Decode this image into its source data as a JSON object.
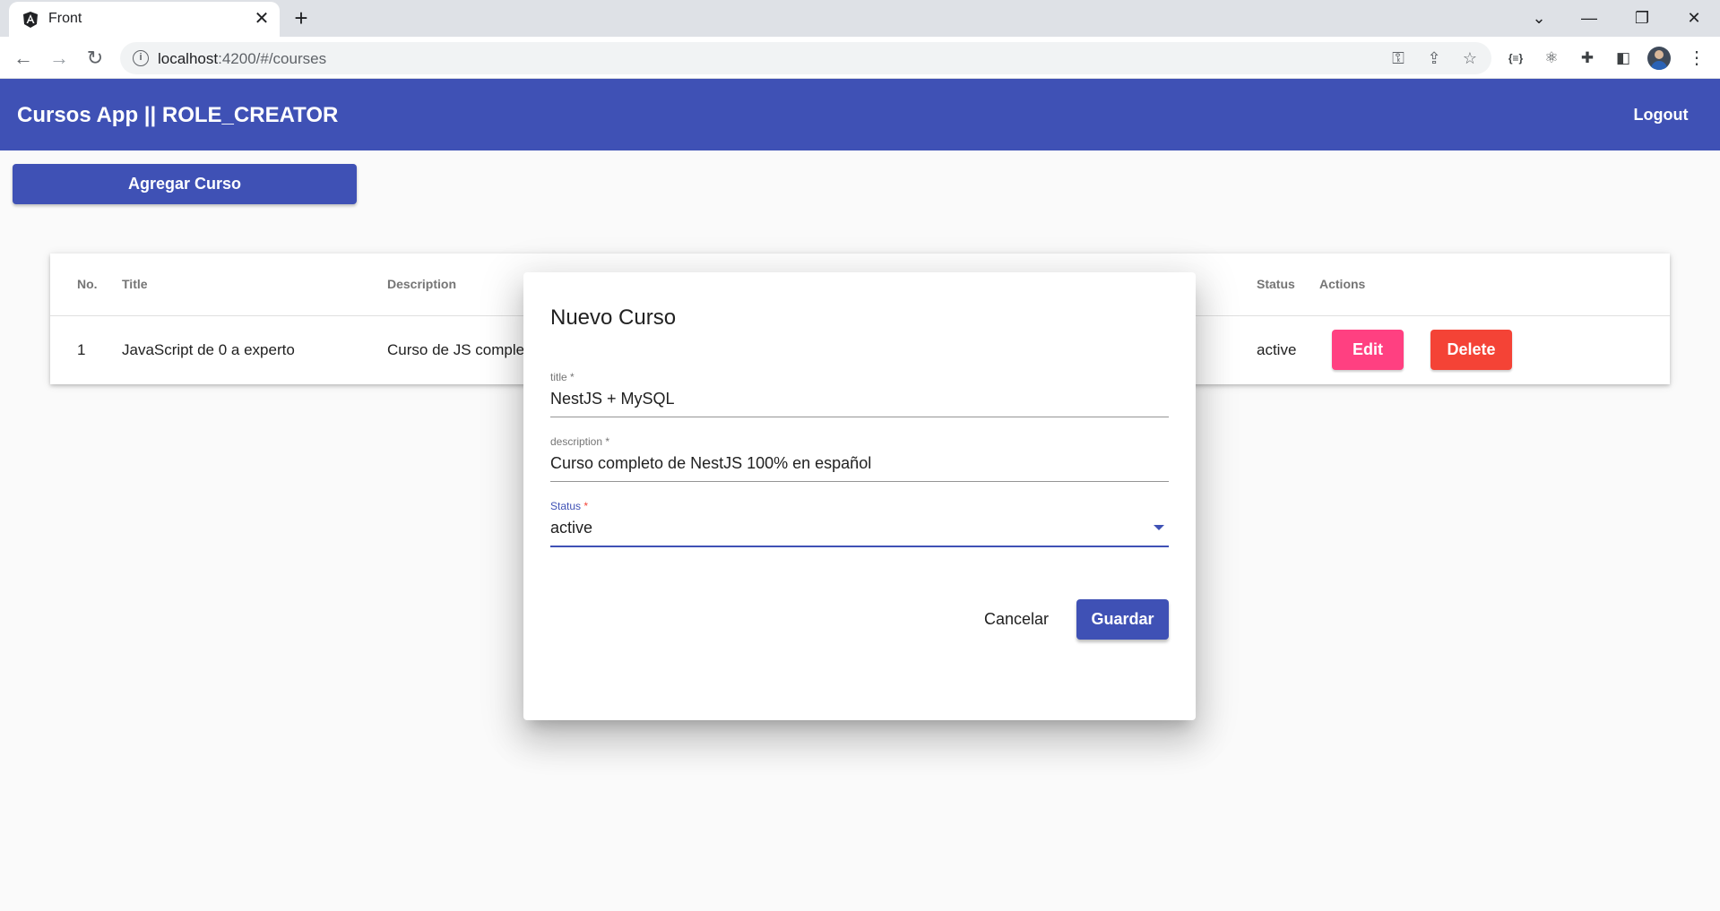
{
  "browser": {
    "tab_title": "Front",
    "url_host": "localhost",
    "url_rest": ":4200/#/courses"
  },
  "app": {
    "title": "Cursos App || ROLE_CREATOR",
    "logout_label": "Logout",
    "add_course_label": "Agregar Curso"
  },
  "table": {
    "headers": {
      "no": "No.",
      "title": "Title",
      "description": "Description",
      "status": "Status",
      "actions": "Actions"
    },
    "rows": [
      {
        "no": "1",
        "title": "JavaScript de 0 a experto",
        "description": "Curso de JS comple",
        "status": "active",
        "edit_label": "Edit",
        "delete_label": "Delete"
      }
    ]
  },
  "dialog": {
    "title": "Nuevo Curso",
    "fields": {
      "title": {
        "label": "title",
        "required_mark": "*",
        "value": "NestJS + MySQL"
      },
      "description": {
        "label": "description",
        "required_mark": "*",
        "value": "Curso completo de NestJS 100% en español"
      },
      "status": {
        "label": "Status",
        "required_mark": "*",
        "value": "active"
      }
    },
    "cancel_label": "Cancelar",
    "save_label": "Guardar"
  },
  "colors": {
    "primary": "#3f51b5",
    "accent": "#ff4081",
    "warn": "#f44336"
  }
}
